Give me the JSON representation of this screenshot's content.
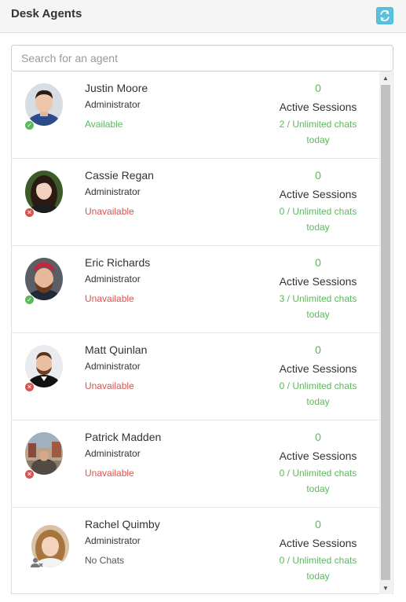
{
  "header": {
    "title": "Desk Agents",
    "refresh_icon": "refresh-icon",
    "accent_color": "#5bc0de"
  },
  "search": {
    "placeholder": "Search for an agent",
    "value": ""
  },
  "agents": [
    {
      "name": "Justin Moore",
      "role": "Administrator",
      "status": "Available",
      "status_type": "available",
      "active_count": "0",
      "sessions_label": "Active Sessions",
      "chats": "2 / Unlimited chats",
      "today": "today"
    },
    {
      "name": "Cassie Regan",
      "role": "Administrator",
      "status": "Unavailable",
      "status_type": "unavailable",
      "active_count": "0",
      "sessions_label": "Active Sessions",
      "chats": "0 / Unlimited chats",
      "today": "today"
    },
    {
      "name": "Eric Richards",
      "role": "Administrator",
      "status": "Unavailable",
      "status_type": "available-icon",
      "active_count": "0",
      "sessions_label": "Active Sessions",
      "chats": "3 / Unlimited chats",
      "today": "today"
    },
    {
      "name": "Matt Quinlan",
      "role": "Administrator",
      "status": "Unavailable",
      "status_type": "unavailable",
      "active_count": "0",
      "sessions_label": "Active Sessions",
      "chats": "0 / Unlimited chats",
      "today": "today"
    },
    {
      "name": "Patrick Madden",
      "role": "Administrator",
      "status": "Unavailable",
      "status_type": "unavailable",
      "active_count": "0",
      "sessions_label": "Active Sessions",
      "chats": "0 / Unlimited chats",
      "today": "today"
    },
    {
      "name": "Rachel Quimby",
      "role": "Administrator",
      "status": "No Chats",
      "status_type": "no-chats",
      "active_count": "0",
      "sessions_label": "Active Sessions",
      "chats": "0 / Unlimited chats",
      "today": "today"
    }
  ],
  "colors": {
    "available": "#5cb85c",
    "unavailable": "#d9534f",
    "no_chats": "#555555"
  }
}
